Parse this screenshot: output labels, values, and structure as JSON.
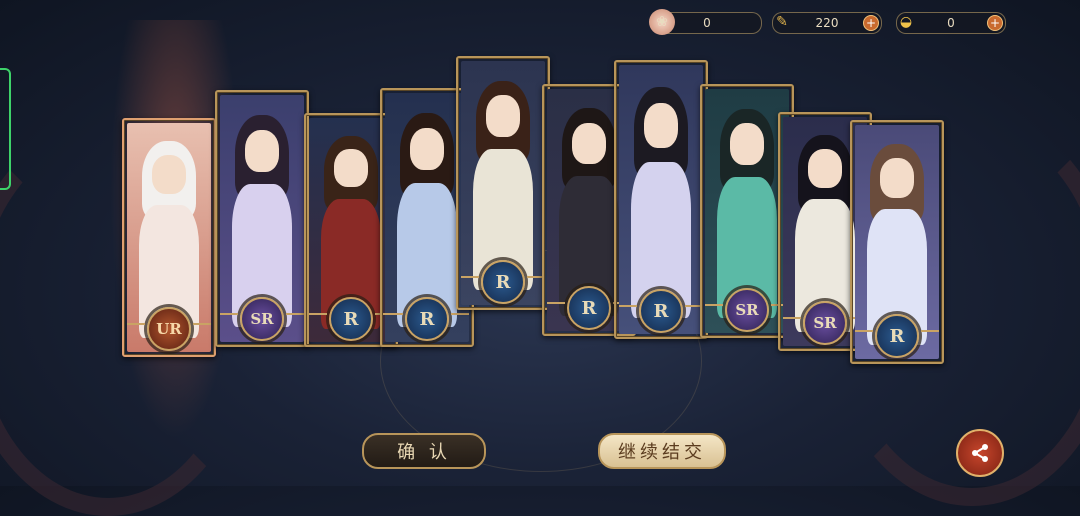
{
  "currencies": [
    {
      "icon": "token-icon",
      "value": "0",
      "has_plus": false
    },
    {
      "icon": "feather-icon",
      "value": "220",
      "has_plus": true
    },
    {
      "icon": "ingot-icon",
      "value": "0",
      "has_plus": true
    }
  ],
  "cards": [
    {
      "rarity": "UR",
      "name": "card-1"
    },
    {
      "rarity": "SR",
      "name": "card-2"
    },
    {
      "rarity": "R",
      "name": "card-3"
    },
    {
      "rarity": "R",
      "name": "card-4"
    },
    {
      "rarity": "R",
      "name": "card-5"
    },
    {
      "rarity": "R",
      "name": "card-6"
    },
    {
      "rarity": "R",
      "name": "card-7"
    },
    {
      "rarity": "SR",
      "name": "card-8"
    },
    {
      "rarity": "SR",
      "name": "card-9"
    },
    {
      "rarity": "R",
      "name": "card-10"
    }
  ],
  "buttons": {
    "confirm_label": "确 认",
    "continue_label": "继续结交"
  },
  "icons": {
    "share": "share-icon"
  },
  "colors": {
    "gold_border": "#b8955a",
    "R": "#2b5a8f",
    "SR": "#6a4fa0",
    "UR": "#b2562d"
  }
}
